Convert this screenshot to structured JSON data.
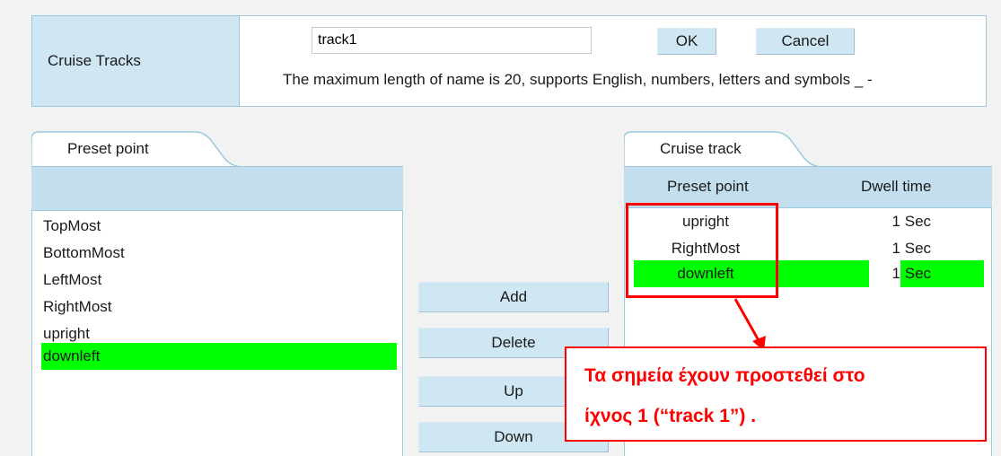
{
  "top": {
    "label": "Cruise Tracks",
    "name_value": "track1",
    "ok_label": "OK",
    "cancel_label": "Cancel",
    "hint": "The maximum length of name is 20, supports English, numbers, letters and symbols _ -"
  },
  "left_panel": {
    "tab": "Preset point",
    "items": [
      "TopMost",
      "BottomMost",
      "LeftMost",
      "RightMost",
      "upright",
      "downleft"
    ],
    "selected": "downleft"
  },
  "actions": {
    "add": "Add",
    "delete": "Delete",
    "up": "Up",
    "down": "Down"
  },
  "right_panel": {
    "tab": "Cruise track",
    "col_point": "Preset point",
    "col_dwell": "Dwell time",
    "rows": [
      {
        "point": "upright",
        "dwell": "1",
        "unit": "Sec"
      },
      {
        "point": "RightMost",
        "dwell": "1",
        "unit": "Sec"
      },
      {
        "point": "downleft",
        "dwell": "1",
        "unit": "Sec"
      }
    ],
    "selected": "downleft"
  },
  "annotation": {
    "line1": "Τα σημεία έχουν προστεθεί στο",
    "line2": "ίχνος 1 (“track 1”) .",
    "color": "#ff0000"
  },
  "colors": {
    "selection": "#00ff00",
    "header": "#c3dfef",
    "label_cell": "#cfe7f3"
  }
}
